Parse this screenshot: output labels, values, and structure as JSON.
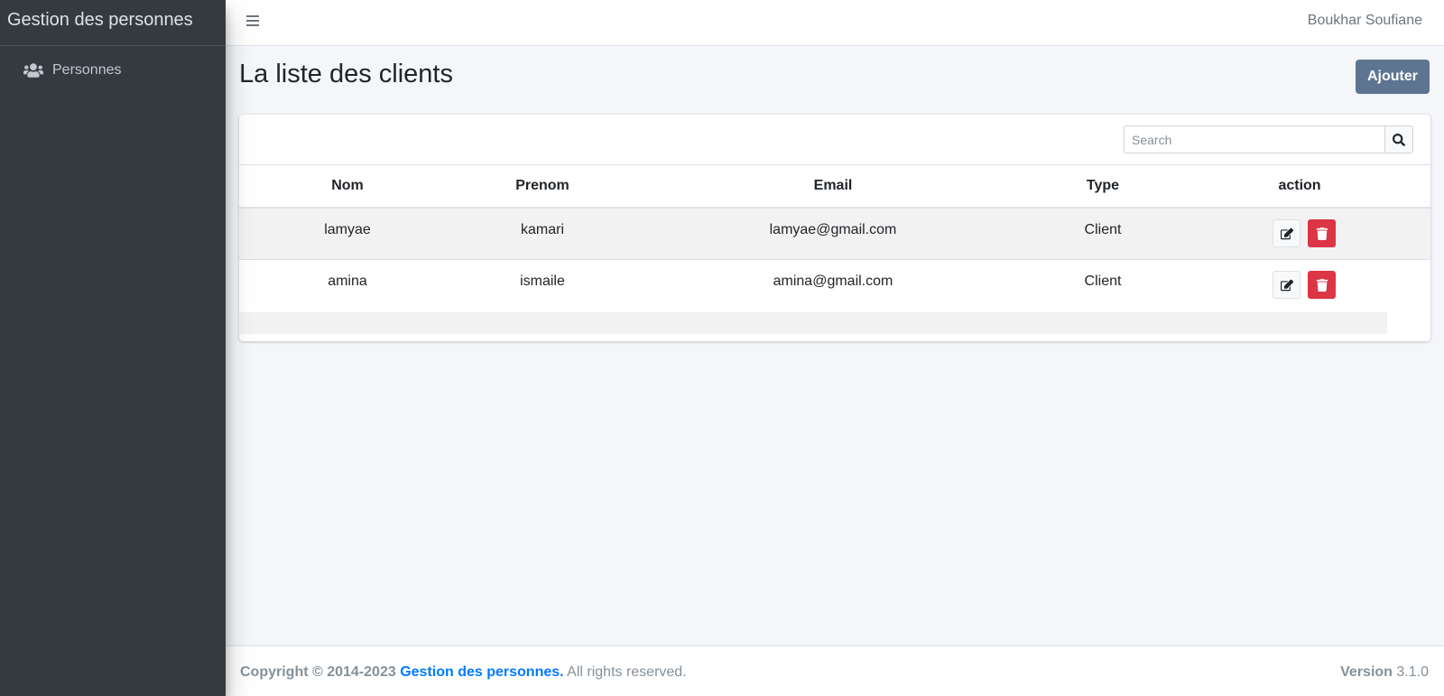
{
  "sidebar": {
    "brand": "Gestion des personnes",
    "items": [
      {
        "label": "Personnes",
        "icon": "users-icon"
      }
    ]
  },
  "topbar": {
    "user_name": "Boukhar Soufiane"
  },
  "page": {
    "title": "La liste des clients",
    "add_label": "Ajouter"
  },
  "search": {
    "placeholder": "Search",
    "value": ""
  },
  "table": {
    "columns": [
      "Nom",
      "Prenom",
      "Email",
      "Type",
      "action"
    ],
    "rows": [
      {
        "nom": "lamyae",
        "prenom": "kamari",
        "email": "lamyae@gmail.com",
        "type": "Client"
      },
      {
        "nom": "amina",
        "prenom": "ismaile",
        "email": "amina@gmail.com",
        "type": "Client"
      }
    ]
  },
  "footer": {
    "copyright": "Copyright © 2014-2023",
    "brand": "Gestion des personnes.",
    "rights": "All rights reserved.",
    "version_label": "Version",
    "version": "3.1.0"
  },
  "colors": {
    "sidebar_bg": "#343a40",
    "primary_button": "#5d7591",
    "danger": "#dc3545",
    "link": "#007bff"
  }
}
